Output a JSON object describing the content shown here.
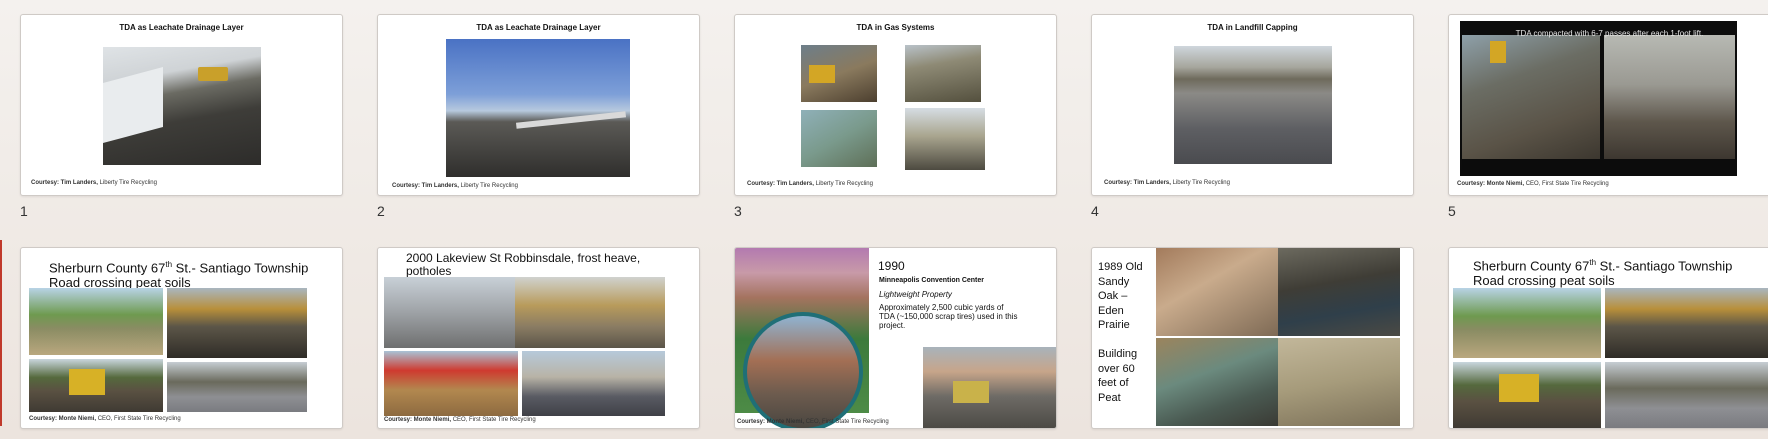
{
  "row1": [
    {
      "number": "1",
      "title": "TDA as Leachate Drainage Layer",
      "credit_name": "Courtesy: Tim Landers,",
      "credit_org": "Liberty Tire Recycling"
    },
    {
      "number": "2",
      "title": "TDA as Leachate Drainage Layer",
      "credit_name": "Courtesy: Tim Landers,",
      "credit_org": "Liberty Tire Recycling"
    },
    {
      "number": "3",
      "title": "TDA in Gas Systems",
      "credit_name": "Courtesy: Tim Landers,",
      "credit_org": "Liberty Tire Recycling"
    },
    {
      "number": "4",
      "title": "TDA in Landfill Capping",
      "credit_name": "Courtesy: Tim Landers,",
      "credit_org": "Liberty Tire Recycling"
    },
    {
      "number": "5",
      "title": "TDA compacted with 6-7 passes after each 1-foot lift.",
      "credit_name": "Courtesy: Monte Niemi,",
      "credit_org": "CEO, First State Tire Recycling"
    }
  ],
  "row2": {
    "s6": {
      "title_a": "Sherburn County 67",
      "title_sup": "th",
      "title_b": " St.- Santiago Township",
      "title_c": "Road crossing peat soils",
      "credit_name": "Courtesy: Monte Niemi,",
      "credit_org": "CEO, First State Tire Recycling"
    },
    "s7": {
      "title_a": "2000 Lakeview St Robbinsdale, frost heave,",
      "title_b": "potholes",
      "credit_name": "Courtesy: Monte Niemi,",
      "credit_org": "CEO, First State Tire Recycling"
    },
    "s8": {
      "year": "1990",
      "place": "Minneapolis Convention Center",
      "subtitle": "Lightweight Property",
      "body": "Approximately 2,500 cubic yards of TDA (~150,000 scrap tires) used in this project.",
      "credit_name": "Courtesy: Monte Niemi,",
      "credit_org": "CEO, First State Tire Recycling"
    },
    "s9": {
      "lines": [
        "1989 Old",
        "Sandy",
        "Oak –",
        "Eden",
        "Prairie",
        "",
        "Building",
        "over 60",
        "feet of",
        "Peat"
      ]
    },
    "s10": {
      "title_a": "Sherburn County 67",
      "title_sup": "th",
      "title_b": " St.- Santiago Township",
      "title_c": "Road crossing peat soils"
    }
  }
}
